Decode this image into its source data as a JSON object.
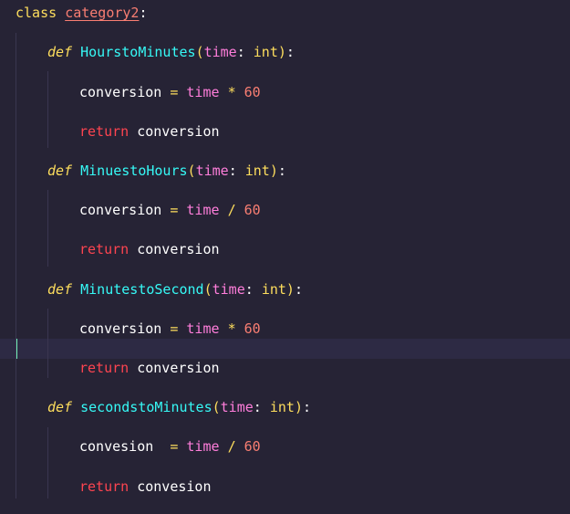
{
  "editor": {
    "line_class": {
      "keyword": "class",
      "name": "category2",
      "colon": ":"
    },
    "methods": [
      {
        "def": "def",
        "name": "HourstoMinutes",
        "open": "(",
        "param": "time",
        "sep": ": ",
        "type": "int",
        "close": ")",
        "colon": ":",
        "body_var": "conversion",
        "body_space": " ",
        "eq": "=",
        "lhs": "time",
        "op": "*",
        "num": "60",
        "ret_kw": "return",
        "ret_val": "conversion"
      },
      {
        "def": "def",
        "name": "MinuestoHours",
        "open": "(",
        "param": "time",
        "sep": ": ",
        "type": "int",
        "close": ")",
        "colon": ":",
        "body_var": "conversion",
        "body_space": " ",
        "eq": "=",
        "lhs": "time",
        "op": "/",
        "num": "60",
        "ret_kw": "return",
        "ret_val": "conversion"
      },
      {
        "def": "def",
        "name": "MinutestoSecond",
        "open": "(",
        "param": "time",
        "sep": ": ",
        "type": "int",
        "close": ")",
        "colon": ":",
        "body_var": "conversion",
        "body_space": " ",
        "eq": "=",
        "lhs": "time",
        "op": "*",
        "num": "60",
        "ret_kw": "return",
        "ret_val": "conversion"
      },
      {
        "def": "def",
        "name": "secondstoMinutes",
        "open": "(",
        "param": "time",
        "sep": ": ",
        "type": "int",
        "close": ")",
        "colon": ":",
        "body_var": "convesion",
        "body_space": "  ",
        "eq": "=",
        "lhs": "time",
        "op": "/",
        "num": "60",
        "ret_kw": "return",
        "ret_val": "convesion"
      }
    ],
    "colors": {
      "background": "#262335",
      "current_line": "#2d2a44",
      "cursor": "#72f1b8",
      "keyword": "#fede5d",
      "return_keyword": "#fe4450",
      "function_name": "#36f9f6",
      "parameter": "#ff7edb",
      "number": "#f97e72"
    }
  }
}
